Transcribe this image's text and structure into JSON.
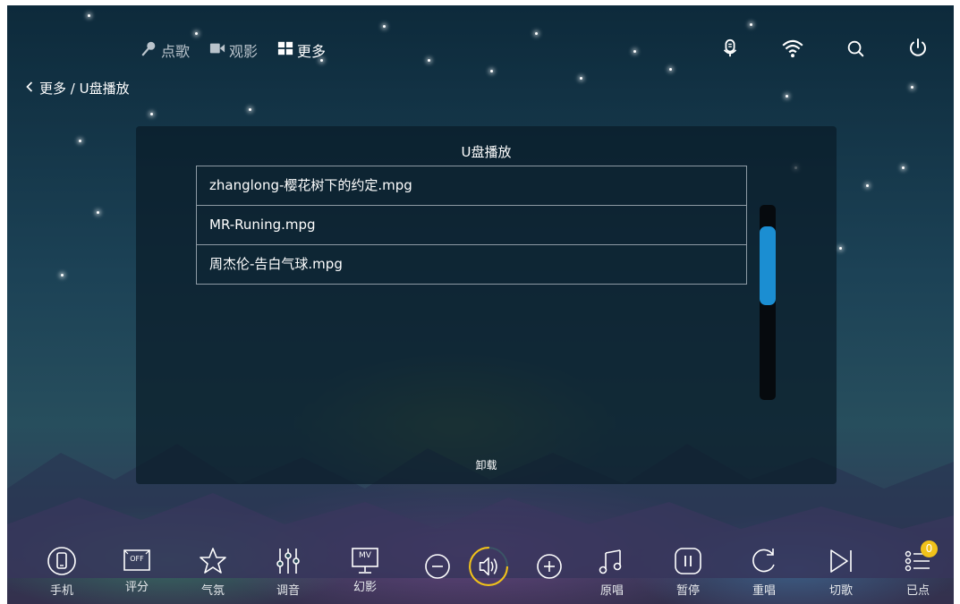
{
  "header": {
    "tabs": [
      {
        "label": "点歌",
        "icon": "microphone-icon"
      },
      {
        "label": "观影",
        "icon": "video-camera-icon"
      },
      {
        "label": "更多",
        "icon": "grid-icon",
        "active": true
      }
    ],
    "icons": [
      "microphone-icon",
      "wifi-icon",
      "search-icon",
      "power-icon"
    ]
  },
  "breadcrumb": {
    "text": "更多 / U盘播放"
  },
  "panel": {
    "title": "U盘播放",
    "files": [
      "zhanglong-樱花树下的约定.mpg",
      "MR-Runing.mpg",
      "周杰伦-告白气球.mpg"
    ],
    "eject_label": "卸载"
  },
  "toolbar": {
    "phone": "手机",
    "score": "评分",
    "score_badge": "OFF",
    "atmosphere": "气氛",
    "tuning": "调音",
    "mv": "幻影",
    "mv_badge": "MV",
    "original": "原唱",
    "pause": "暂停",
    "replay": "重唱",
    "skip": "切歌",
    "selected": "已点",
    "selected_count": "0"
  },
  "colors": {
    "accent": "#1b8ed2",
    "badge": "#f1c21a",
    "volume_ring": "#f1c21a"
  }
}
